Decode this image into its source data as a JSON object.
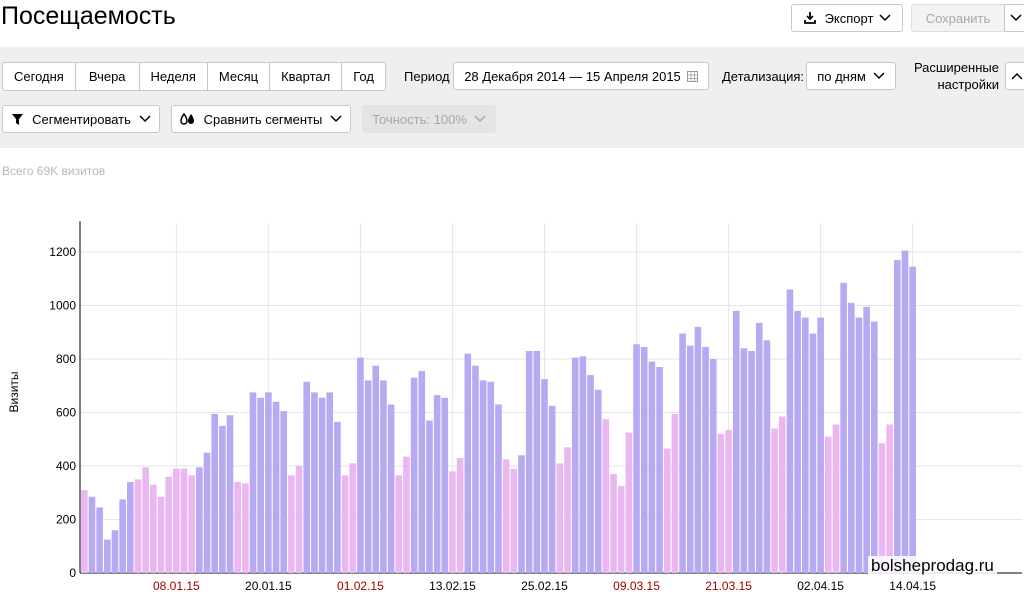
{
  "header": {
    "title": "Посещаемость",
    "export_label": "Экспорт",
    "save_label": "Сохранить"
  },
  "toolbar": {
    "periods": [
      "Сегодня",
      "Вчера",
      "Неделя",
      "Месяц",
      "Квартал",
      "Год"
    ],
    "period_label": "Период",
    "period_value": "28 Декабря 2014 — 15 Апреля 2015",
    "detail_label": "Детализация:",
    "detail_value": "по дням",
    "advanced_line1": "Расширенные",
    "advanced_line2": "настройки",
    "segment_label": "Сегментировать",
    "compare_label": "Сравнить сегменты",
    "accuracy_label": "Точность: 100%"
  },
  "summary": {
    "total_text": "Всего 69K визитов"
  },
  "watermark": "bolsheprodag.ru",
  "colors": {
    "weekday": "#b7a9f2",
    "weekend": "#eab7f2",
    "holiday_tick": "#a00000",
    "tick": "#000000",
    "grid": "#e6e6e6"
  },
  "chart_data": {
    "type": "bar",
    "ylabel": "Визиты",
    "ylim": [
      0,
      1300
    ],
    "yticks": [
      0,
      200,
      400,
      600,
      800,
      1000,
      1200
    ],
    "start_date": "2014-12-28",
    "x_tick_labels": [
      {
        "label": "08.01.15",
        "holiday": true
      },
      {
        "label": "20.01.15",
        "holiday": false
      },
      {
        "label": "01.02.15",
        "holiday": true
      },
      {
        "label": "13.02.15",
        "holiday": false
      },
      {
        "label": "25.02.15",
        "holiday": false
      },
      {
        "label": "09.03.15",
        "holiday": true
      },
      {
        "label": "21.03.15",
        "holiday": true
      },
      {
        "label": "02.04.15",
        "holiday": false
      },
      {
        "label": "14.04.15",
        "holiday": false
      }
    ],
    "values": [
      310,
      285,
      245,
      125,
      160,
      275,
      340,
      350,
      395,
      330,
      285,
      360,
      390,
      390,
      365,
      395,
      450,
      595,
      550,
      590,
      340,
      335,
      675,
      655,
      675,
      640,
      605,
      365,
      400,
      715,
      675,
      655,
      675,
      565,
      365,
      410,
      805,
      720,
      775,
      720,
      630,
      365,
      435,
      730,
      755,
      570,
      665,
      655,
      380,
      430,
      820,
      775,
      720,
      715,
      630,
      425,
      390,
      440,
      830,
      830,
      725,
      625,
      410,
      470,
      805,
      810,
      740,
      685,
      575,
      370,
      325,
      525,
      855,
      845,
      790,
      770,
      465,
      595,
      895,
      850,
      920,
      845,
      800,
      520,
      535,
      980,
      840,
      830,
      935,
      870,
      540,
      585,
      1060,
      980,
      955,
      895,
      955,
      510,
      555,
      1085,
      1010,
      955,
      995,
      940,
      485,
      555,
      1170,
      1205,
      1145
    ],
    "weekend": [
      true,
      false,
      false,
      false,
      false,
      false,
      false,
      true,
      true,
      true,
      true,
      true,
      true,
      true,
      true,
      false,
      false,
      false,
      false,
      false,
      true,
      true,
      false,
      false,
      false,
      false,
      false,
      true,
      true,
      false,
      false,
      false,
      false,
      false,
      true,
      true,
      false,
      false,
      false,
      false,
      false,
      true,
      true,
      false,
      false,
      false,
      false,
      false,
      true,
      true,
      false,
      false,
      false,
      false,
      false,
      true,
      true,
      false,
      false,
      false,
      false,
      false,
      true,
      true,
      false,
      false,
      false,
      false,
      true,
      true,
      true,
      true,
      false,
      false,
      false,
      false,
      true,
      true,
      false,
      false,
      false,
      false,
      false,
      true,
      true,
      false,
      false,
      false,
      false,
      false,
      true,
      true,
      false,
      false,
      false,
      false,
      false,
      true,
      true,
      false,
      false,
      false,
      false,
      false,
      true,
      true,
      false,
      false,
      false
    ]
  }
}
